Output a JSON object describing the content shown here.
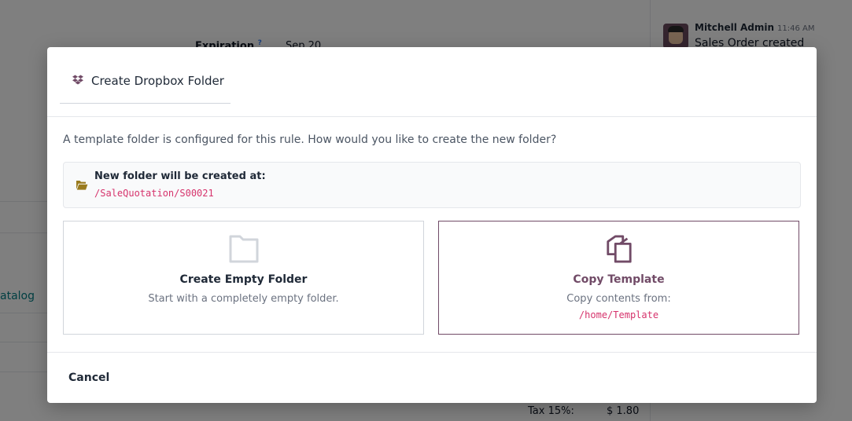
{
  "background": {
    "expiration_label": "Expiration",
    "expiration_help": "?",
    "expiration_value": "Sep 20",
    "catalog_link": "atalog",
    "tax_label": "Tax 15%:",
    "tax_value": "$ 1.80",
    "chatter": {
      "author": "Mitchell Admin",
      "time": "11:46 AM",
      "message": "Sales Order created"
    }
  },
  "dialog": {
    "title": "Create Dropbox Folder",
    "title_icon": "dropbox-icon",
    "intro": "A template folder is configured for this rule. How would you like to create the new folder?",
    "location": {
      "icon": "folder-open-icon",
      "label": "New folder will be created at:",
      "path": "/SaleQuotation/S00021"
    },
    "options": {
      "empty": {
        "icon": "folder-icon",
        "title": "Create Empty Folder",
        "description": "Start with a completely empty folder."
      },
      "template": {
        "icon": "copy-icon",
        "title": "Copy Template",
        "description": "Copy contents from:",
        "path": "/home/Template"
      }
    },
    "cancel_label": "Cancel"
  },
  "colors": {
    "accent": "#714b67",
    "path_text": "#d6336c",
    "folder_icon": "#9a7b1e"
  }
}
